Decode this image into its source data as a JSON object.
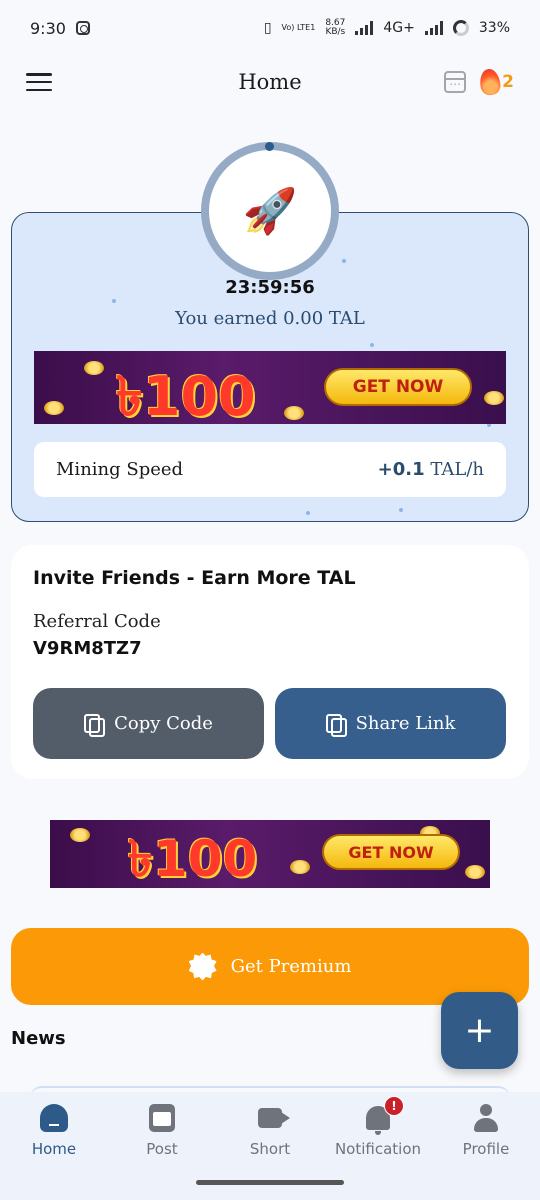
{
  "status_bar": {
    "time": "9:30",
    "network_tag": "Vo) LTE1",
    "speed": "8.67",
    "speed_unit": "KB/s",
    "network_type": "4G+",
    "battery": "33%"
  },
  "header": {
    "title": "Home",
    "streak_count": "2"
  },
  "mining": {
    "timer": "23:59:56",
    "earned_text": "You earned 0.00 TAL",
    "speed_label": "Mining Speed",
    "speed_value": "+0.1",
    "speed_unit": "TAL/h",
    "timer_progress": 0.0
  },
  "ads": {
    "amount": "৳100",
    "cta": "GET NOW"
  },
  "invite": {
    "title": "Invite Friends - Earn More TAL",
    "referral_label": "Referral Code",
    "referral_code": "V9RM8TZ7",
    "copy_button": "Copy Code",
    "share_button": "Share Link"
  },
  "premium": {
    "label": "Get Premium"
  },
  "news": {
    "title": "News"
  },
  "fab": {
    "label": "+"
  },
  "bottom_nav": {
    "items": [
      {
        "label": "Home",
        "icon": "home-icon",
        "active": true
      },
      {
        "label": "Post",
        "icon": "post-icon",
        "active": false
      },
      {
        "label": "Short",
        "icon": "video-icon",
        "active": false
      },
      {
        "label": "Notification",
        "icon": "bell-icon",
        "active": false,
        "badge": "!"
      },
      {
        "label": "Profile",
        "icon": "profile-icon",
        "active": false
      }
    ]
  },
  "colors": {
    "primary": "#365f8e",
    "card_bg": "#dbe8fc",
    "premium": "#fb9a06",
    "streak": "#f39c12",
    "badge": "#c9202a"
  }
}
